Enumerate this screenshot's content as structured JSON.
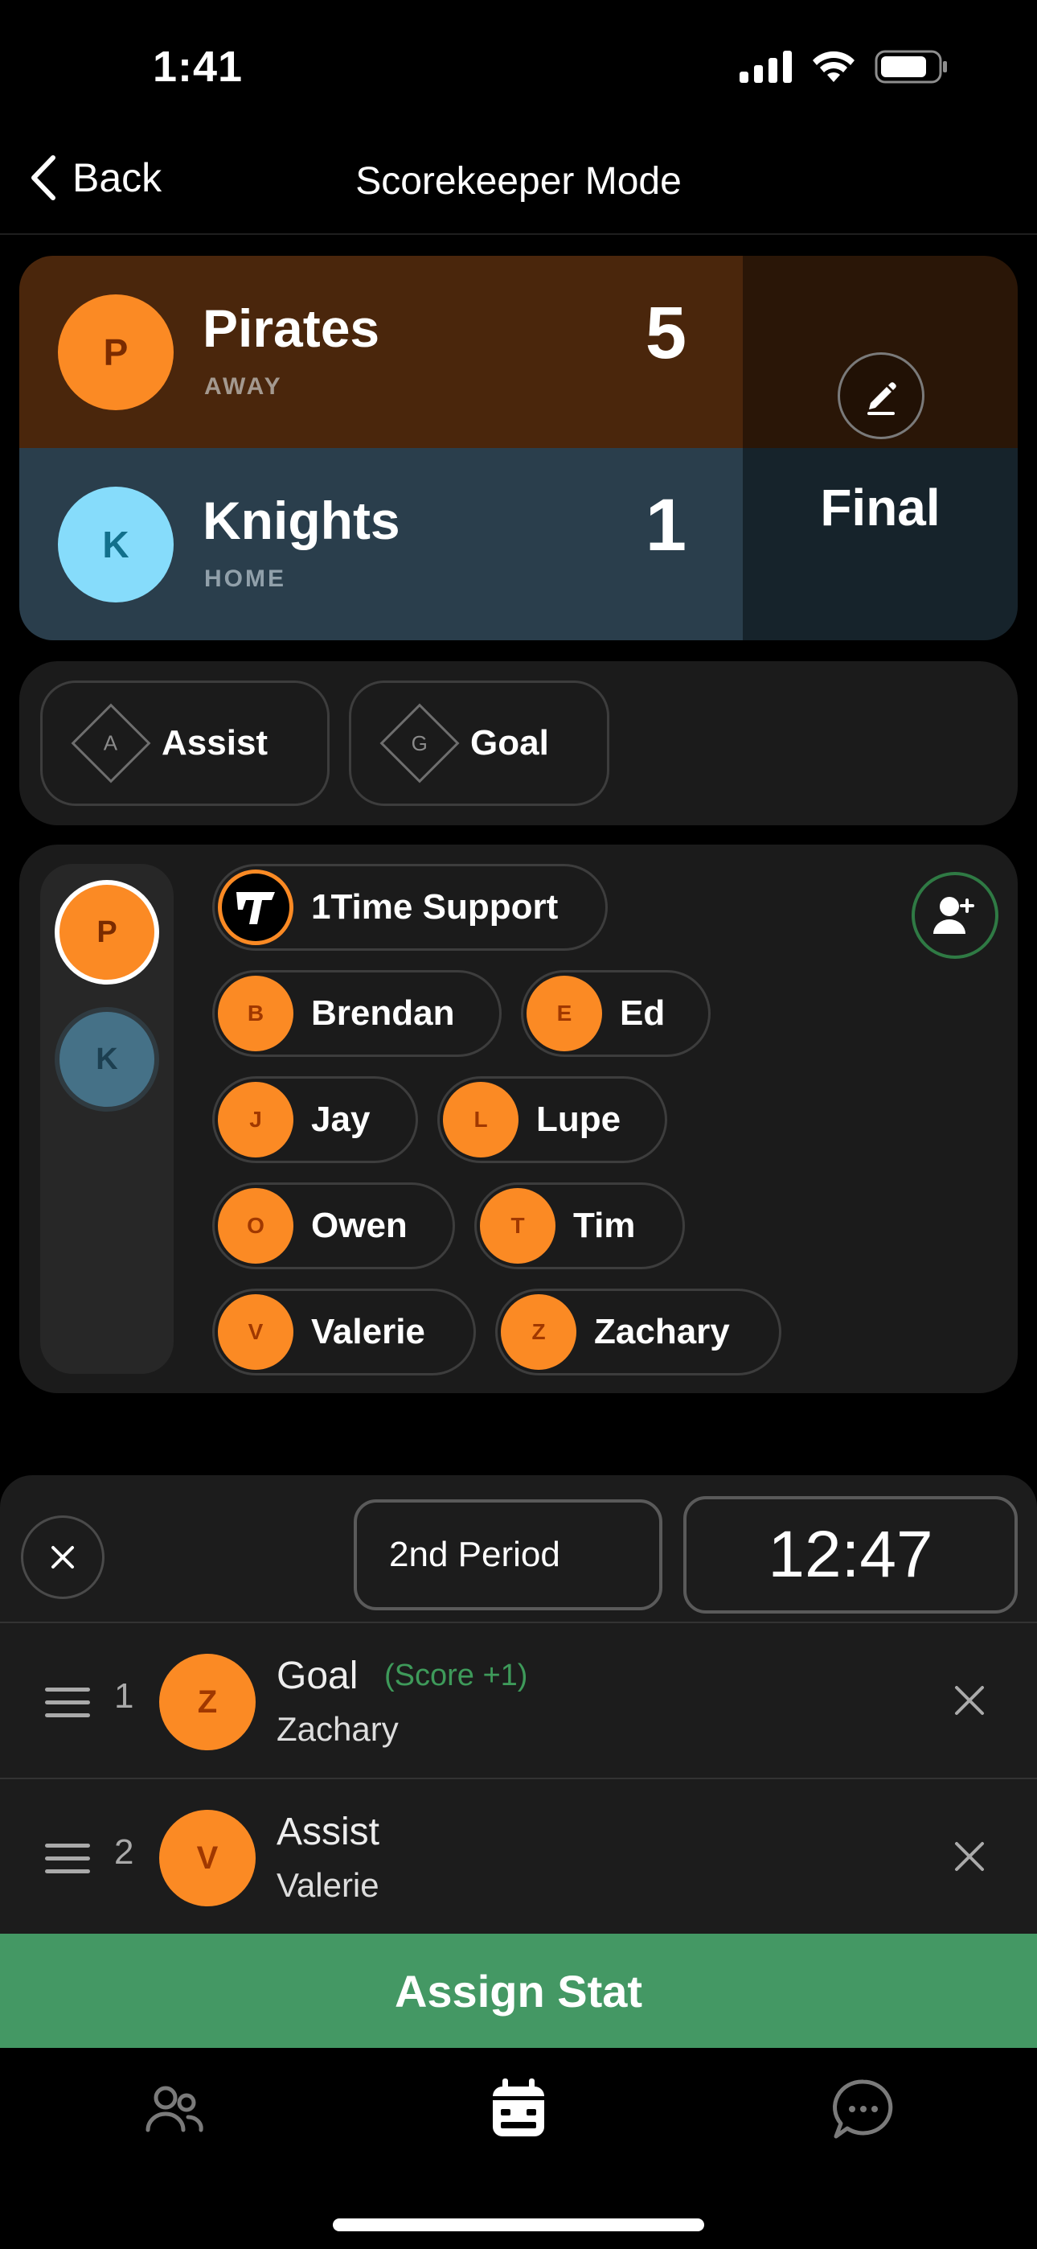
{
  "status_bar": {
    "time": "1:41"
  },
  "nav": {
    "back_label": "Back",
    "title": "Scorekeeper Mode"
  },
  "game": {
    "away": {
      "initial": "P",
      "name": "Pirates",
      "side": "AWAY",
      "score": "5"
    },
    "home": {
      "initial": "K",
      "name": "Knights",
      "side": "HOME",
      "score": "1"
    },
    "status": "Final"
  },
  "stat_types": [
    {
      "icon": "A",
      "label": "Assist"
    },
    {
      "icon": "G",
      "label": "Goal"
    }
  ],
  "roster": {
    "team_initials": [
      "P",
      "K"
    ],
    "players": [
      {
        "initial": "",
        "name": "1Time Support"
      },
      {
        "initial": "B",
        "name": "Brendan"
      },
      {
        "initial": "E",
        "name": "Ed"
      },
      {
        "initial": "J",
        "name": "Jay"
      },
      {
        "initial": "L",
        "name": "Lupe"
      },
      {
        "initial": "O",
        "name": "Owen"
      },
      {
        "initial": "T",
        "name": "Tim"
      },
      {
        "initial": "V",
        "name": "Valerie"
      },
      {
        "initial": "Z",
        "name": "Zachary"
      }
    ]
  },
  "timer": {
    "period": "2nd Period",
    "clock": "12:47"
  },
  "stat_log": [
    {
      "index": "1",
      "initial": "Z",
      "stat": "Goal",
      "note": "(Score +1)",
      "player": "Zachary"
    },
    {
      "index": "2",
      "initial": "V",
      "stat": "Assist",
      "note": "",
      "player": "Valerie"
    }
  ],
  "assign_label": "Assign Stat",
  "colors": {
    "accent_orange": "#fb8a24",
    "accent_green": "#449864",
    "away_bg": "#4a260c",
    "home_bg": "#2a3e4c"
  }
}
